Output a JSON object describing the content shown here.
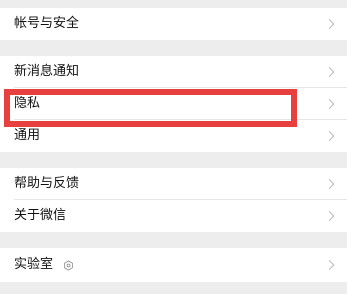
{
  "settings": {
    "groups": [
      {
        "items": [
          {
            "label": "帐号与安全"
          }
        ]
      },
      {
        "items": [
          {
            "label": "新消息通知"
          },
          {
            "label": "隐私"
          },
          {
            "label": "通用"
          }
        ]
      },
      {
        "items": [
          {
            "label": "帮助与反馈"
          },
          {
            "label": "关于微信"
          }
        ]
      },
      {
        "items": [
          {
            "label": "实验室",
            "icon": "lab-badge-icon"
          }
        ]
      }
    ]
  },
  "highlight": {
    "target": "隐私",
    "color": "#e8403e"
  }
}
